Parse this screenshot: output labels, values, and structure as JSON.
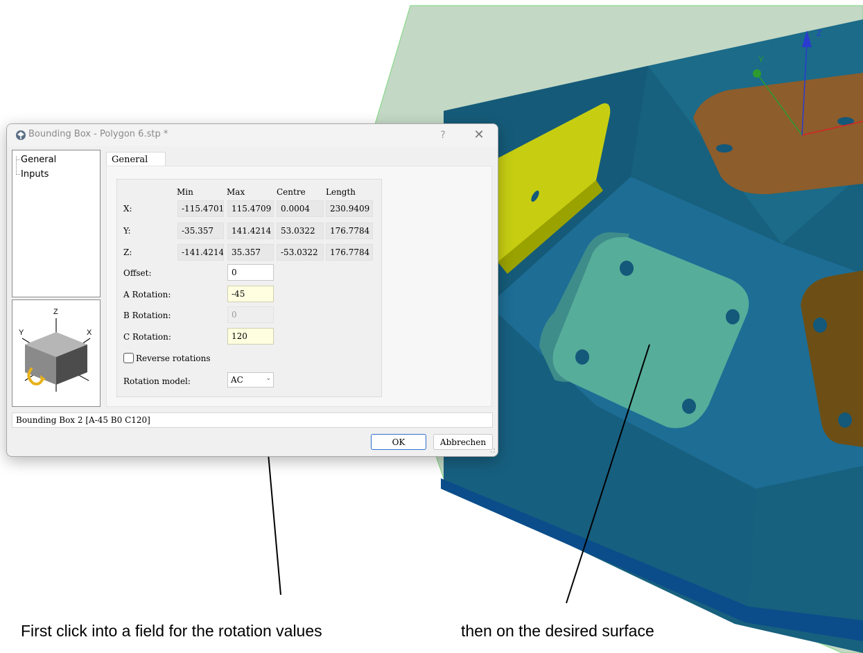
{
  "dialog": {
    "title": "Bounding Box - Polygon 6.stp *",
    "help": "?",
    "close": "✕",
    "tree_items": [
      "General",
      "Inputs"
    ],
    "tab": "General",
    "columns": [
      "Min",
      "Max",
      "Centre",
      "Length"
    ],
    "rows": [
      {
        "label": "X:",
        "min": "-115.4701",
        "max": "115.4709",
        "centre": "0.0004",
        "length": "230.9409"
      },
      {
        "label": "Y:",
        "min": "-35.357",
        "max": "141.4214",
        "centre": "53.0322",
        "length": "176.7784"
      },
      {
        "label": "Z:",
        "min": "-141.4214",
        "max": "35.357",
        "centre": "-53.0322",
        "length": "176.7784"
      }
    ],
    "offset": {
      "label": "Offset:",
      "value": "0"
    },
    "a_rotation": {
      "label": "A Rotation:",
      "value": "-45"
    },
    "b_rotation": {
      "label": "B Rotation:",
      "value": "0"
    },
    "c_rotation": {
      "label": "C Rotation:",
      "value": "120"
    },
    "reverse_rotations": {
      "label": "Reverse rotations",
      "checked": false
    },
    "rotation_model": {
      "label": "Rotation model:",
      "value": "AC"
    },
    "status": "Bounding Box 2 [A-45 B0 C120]",
    "ok": "OK",
    "cancel": "Abbrechen",
    "preview_axes": {
      "z": "Z",
      "y": "Y",
      "x": "X"
    }
  },
  "viewport": {
    "axis_y": "Y",
    "axis_z": "Z"
  },
  "captions": {
    "left": "First click into a field for the rotation values",
    "right": "then on the desired surface"
  }
}
